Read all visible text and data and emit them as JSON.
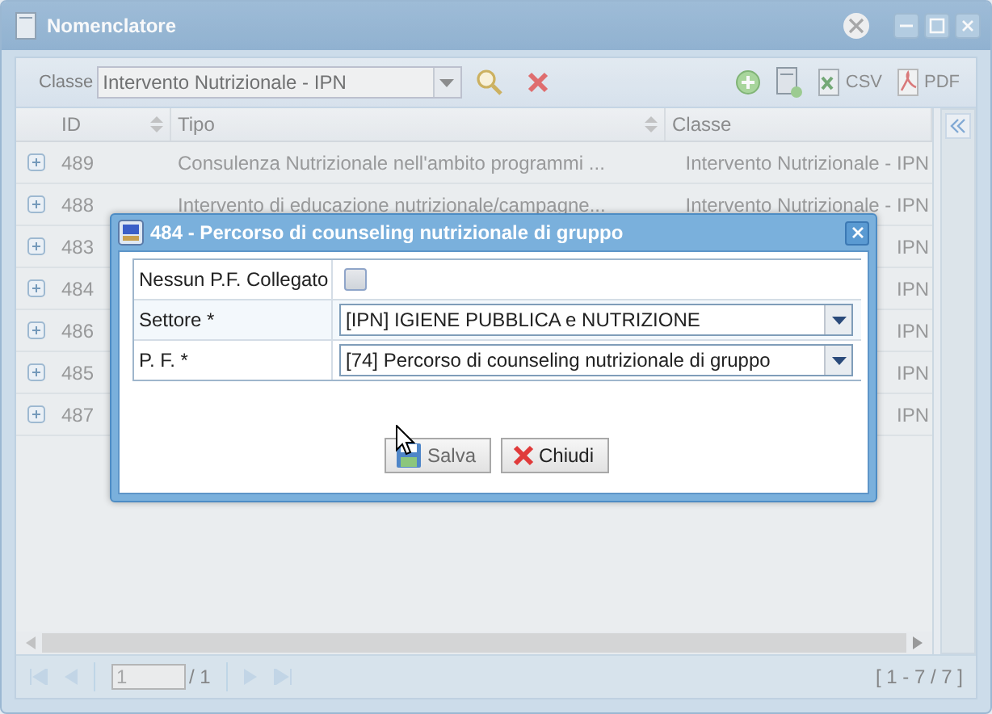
{
  "window": {
    "title": "Nomenclatore"
  },
  "toolbar": {
    "filter_label": "Classe",
    "filter_value": "Intervento Nutrizionale - IPN",
    "csv": "CSV",
    "pdf": "PDF"
  },
  "grid": {
    "columns": [
      "ID",
      "Tipo",
      "Classe"
    ],
    "rows": [
      {
        "id": "489",
        "tipo": "Consulenza Nutrizionale nell'ambito programmi ...",
        "classe": "Intervento Nutrizionale - IPN"
      },
      {
        "id": "488",
        "tipo": "Intervento di educazione nutrizionale/campagne...",
        "classe": "Intervento Nutrizionale - IPN"
      },
      {
        "id": "483",
        "classe": "IPN"
      },
      {
        "id": "484",
        "classe": "IPN"
      },
      {
        "id": "486",
        "classe": "IPN"
      },
      {
        "id": "485",
        "classe": "IPN"
      },
      {
        "id": "487",
        "classe": "IPN"
      }
    ]
  },
  "pager": {
    "page": "1",
    "of": "/ 1",
    "summary": "[ 1 - 7 / 7 ]"
  },
  "dialog": {
    "title": "484 - Percorso di counseling nutrizionale di gruppo",
    "fields": [
      {
        "kind": "checkbox",
        "label": "Nessun P.F. Collegato",
        "checked": false
      },
      {
        "kind": "combo",
        "label": "Settore *",
        "value": "[IPN] IGIENE PUBBLICA e NUTRIZIONE"
      },
      {
        "kind": "combo",
        "label": "P. F. *",
        "value": "[74] Percorso di counseling nutrizionale di gruppo"
      }
    ],
    "buttons": [
      {
        "kind": "save",
        "label": "Salva",
        "disabled": true
      },
      {
        "kind": "close",
        "label": "Chiudi",
        "disabled": false
      }
    ]
  }
}
